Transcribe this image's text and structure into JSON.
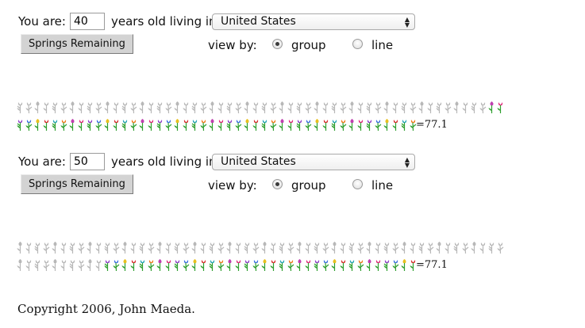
{
  "calculators": [
    {
      "age_label": "You are:",
      "age_value": "40",
      "living_label": "years old living in",
      "country": "United States",
      "button_label": "Springs Remaining",
      "view_by_label": "view by:",
      "radio_group_label": "group",
      "radio_line_label": "line",
      "view_mode": "group",
      "result": "=77.1",
      "flowers": {
        "row1": [
          "g",
          "g",
          "g",
          "g",
          "g",
          "g",
          "g",
          "g",
          "g",
          "g",
          "g",
          "g",
          "g",
          "g",
          "g",
          "g",
          "g",
          "g",
          "g",
          "g",
          "g",
          "g",
          "g",
          "g",
          "g",
          "g",
          "g",
          "g",
          "g",
          "g",
          "g",
          "g",
          "g",
          "g",
          "g",
          "g",
          "g",
          "g",
          "g",
          "g",
          "g",
          "g",
          "g",
          "g",
          "g",
          "g",
          "g",
          "g",
          "g",
          "g",
          "g",
          "g",
          "g",
          "g",
          "c",
          "c"
        ],
        "row2": [
          "c",
          "c",
          "c",
          "c",
          "c",
          "c",
          "c",
          "c",
          "c",
          "c",
          "c",
          "c",
          "c",
          "c",
          "c",
          "c",
          "c",
          "c",
          "c",
          "c",
          "c",
          "c",
          "c",
          "c",
          "c",
          "c",
          "c",
          "c",
          "c",
          "c",
          "c",
          "c",
          "c",
          "c",
          "c",
          "c",
          "c",
          "c",
          "c",
          "c",
          "c",
          "c",
          "c",
          "c",
          "c",
          "c"
        ]
      }
    },
    {
      "age_label": "You are:",
      "age_value": "50",
      "living_label": "years old living in",
      "country": "United States",
      "button_label": "Springs Remaining",
      "view_by_label": "view by:",
      "radio_group_label": "group",
      "radio_line_label": "line",
      "view_mode": "group",
      "result": "=77.1",
      "flowers": {
        "row1": [
          "g",
          "g",
          "g",
          "g",
          "g",
          "g",
          "g",
          "g",
          "g",
          "g",
          "g",
          "g",
          "g",
          "g",
          "g",
          "g",
          "g",
          "g",
          "g",
          "g",
          "g",
          "g",
          "g",
          "g",
          "g",
          "g",
          "g",
          "g",
          "g",
          "g",
          "g",
          "g",
          "g",
          "g",
          "g",
          "g",
          "g",
          "g",
          "g",
          "g",
          "g",
          "g",
          "g",
          "g",
          "g",
          "g",
          "g",
          "g",
          "g",
          "g",
          "g",
          "g",
          "g",
          "g",
          "g",
          "g"
        ],
        "row2": [
          "g",
          "g",
          "g",
          "g",
          "g",
          "g",
          "g",
          "g",
          "g",
          "g",
          "c",
          "c",
          "c",
          "c",
          "c",
          "c",
          "c",
          "c",
          "c",
          "c",
          "c",
          "c",
          "c",
          "c",
          "c",
          "c",
          "c",
          "c",
          "c",
          "c",
          "c",
          "c",
          "c",
          "c",
          "c",
          "c",
          "c",
          "c",
          "c",
          "c",
          "c",
          "c",
          "c",
          "c",
          "c",
          "c"
        ]
      }
    }
  ],
  "copyright": "Copyright 2006, John Maeda.",
  "colors": {
    "spent_flower": "#b8b8b8",
    "stem": "#2e9e2e",
    "petals": [
      "#e0287a",
      "#8e3fc9",
      "#3b6fe0",
      "#e8c020",
      "#d83030",
      "#2aa6b8",
      "#f07a1a",
      "#c040b0"
    ]
  }
}
